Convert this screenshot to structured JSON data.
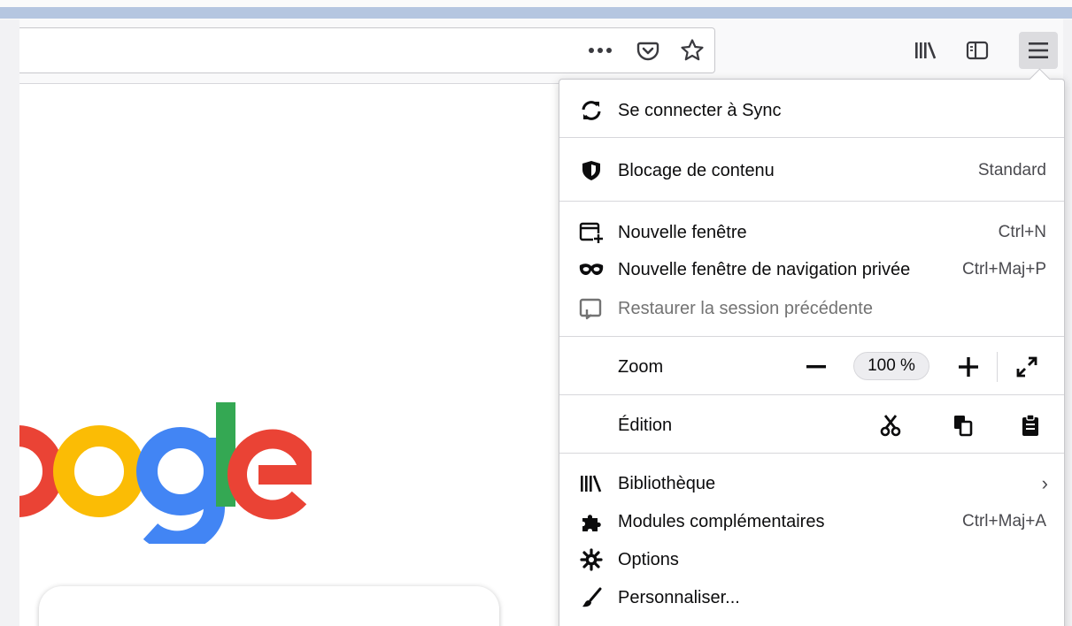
{
  "toolbar": {
    "page_actions_icon": "ellipsis-icon",
    "pocket_icon": "pocket-icon",
    "bookmark_icon": "star-icon",
    "library_icon": "library-icon",
    "sidebar_icon": "sidebar-icon",
    "menu_icon": "hamburger-icon"
  },
  "page": {
    "logo_partial": "oogle",
    "logo_colors": {
      "red": "#EA4335",
      "yellow": "#FBBC05",
      "blue": "#4285F4",
      "green": "#34A853"
    }
  },
  "menu": {
    "sync": {
      "label": "Se connecter à Sync",
      "icon": "sync-icon"
    },
    "blocking": {
      "label": "Blocage de contenu",
      "value": "Standard",
      "icon": "shield-icon"
    },
    "new_window": {
      "label": "Nouvelle fenêtre",
      "shortcut": "Ctrl+N",
      "icon": "new-window-icon"
    },
    "private_window": {
      "label": "Nouvelle fenêtre de navigation privée",
      "shortcut": "Ctrl+Maj+P",
      "icon": "private-mask-icon"
    },
    "restore_session": {
      "label": "Restaurer la session précédente",
      "icon": "restore-session-icon",
      "disabled": true
    },
    "zoom": {
      "label": "Zoom",
      "value": "100 %",
      "minus_icon": "minus-icon",
      "plus_icon": "plus-icon",
      "fullscreen_icon": "fullscreen-icon"
    },
    "edit": {
      "label": "Édition",
      "cut_icon": "scissors-icon",
      "copy_icon": "copy-icon",
      "paste_icon": "clipboard-icon"
    },
    "library": {
      "label": "Bibliothèque",
      "icon": "library-icon",
      "arrow": "›"
    },
    "addons": {
      "label": "Modules complémentaires",
      "shortcut": "Ctrl+Maj+A",
      "icon": "puzzle-icon"
    },
    "options": {
      "label": "Options",
      "icon": "gear-icon"
    },
    "customize": {
      "label": "Personnaliser...",
      "icon": "brush-icon"
    }
  }
}
